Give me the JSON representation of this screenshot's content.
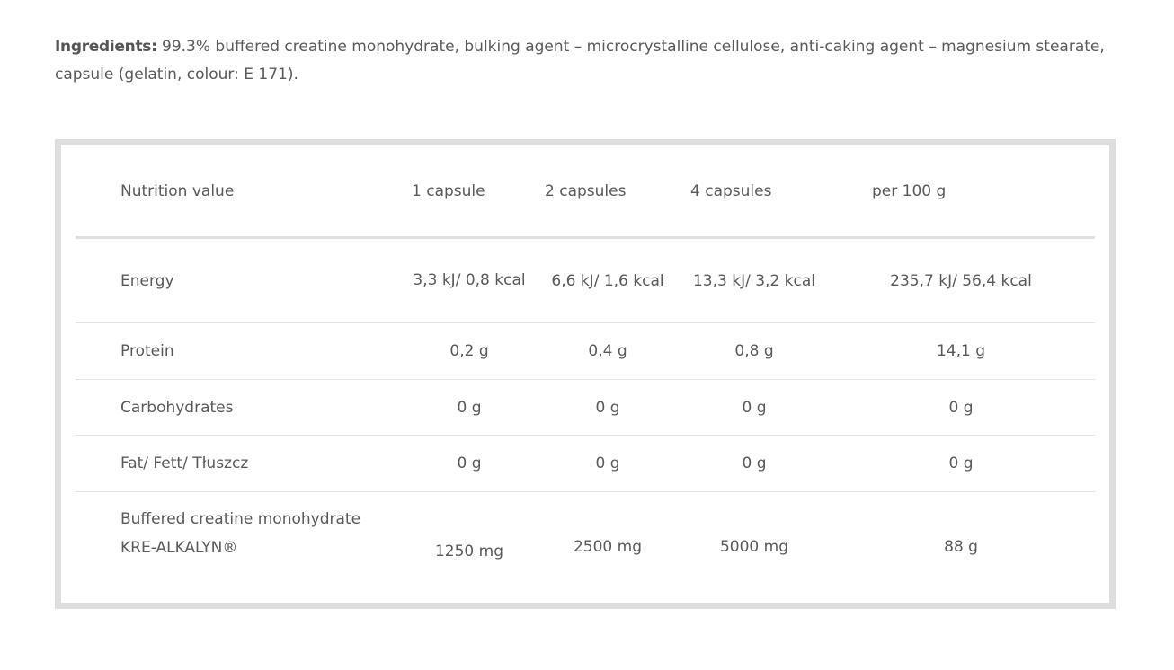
{
  "ingredients": {
    "label": "Ingredients:",
    "text": " 99.3% buffered creatine monohydrate, bulking agent – microcrystalline cellulose, anti-caking agent – magnesium stearate, capsule (gelatin, colour: E 171)."
  },
  "table": {
    "headers": [
      "Nutrition value",
      "1 capsule",
      "2 capsules",
      "4 capsules",
      "per 100 g"
    ],
    "rows": [
      {
        "name": "Energy",
        "values": [
          "3,3 kJ/ 0,8 kcal",
          "6,6 kJ/ 1,6 kcal",
          "13,3 kJ/ 3,2 kcal",
          "235,7 kJ/  56,4 kcal"
        ]
      },
      {
        "name": "Protein",
        "values": [
          "0,2 g",
          "0,4 g",
          "0,8 g",
          "14,1 g"
        ]
      },
      {
        "name": "Carbohydrates",
        "values": [
          "0 g",
          "0 g",
          "0 g",
          "0 g"
        ]
      },
      {
        "name": "Fat/ Fett/ Tłuszcz",
        "values": [
          "0 g",
          "0 g",
          "0 g",
          "0 g"
        ]
      },
      {
        "name": "Buffered creatine monohydrate KRE-ALKALYN®",
        "values": [
          "1250 mg",
          "2500 mg",
          "5000 mg",
          "88 g"
        ]
      }
    ]
  },
  "colors": {
    "text": "#5a5a5a",
    "border": "#dedede",
    "divider": "#e3e3e3"
  }
}
